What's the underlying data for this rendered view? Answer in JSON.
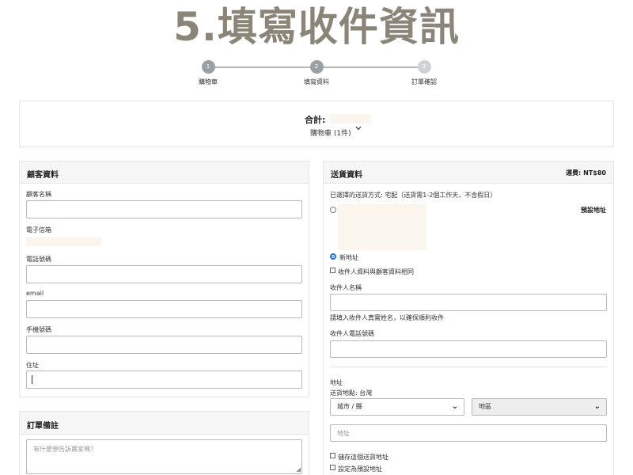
{
  "banner": {
    "title": "5.填寫收件資訊"
  },
  "steps": [
    {
      "number": "1",
      "label": "購物車",
      "color": "#9aa0a6"
    },
    {
      "number": "2",
      "label": "填寫資料",
      "color": "#9aa0a6"
    },
    {
      "number": "3",
      "label": "訂單確認",
      "color": "#cfd2d5"
    }
  ],
  "summary": {
    "total_label": "合計:",
    "cart_label": "購物車 (1件)"
  },
  "customer": {
    "title": "顧客資料",
    "name_label": "顧客名稱",
    "email_label": "電子信箱",
    "phone_label": "電話號碼",
    "email2_label": "email",
    "mobile_label": "手機號碼",
    "address_label": "住址"
  },
  "note": {
    "title": "訂單備註",
    "placeholder": "有什麼想告訴賣家嗎？"
  },
  "shipping": {
    "title": "送貨資料",
    "fee": "運費: NT$80",
    "method": "已選擇的送貨方式: 宅配（送貨需1-2個工作天，不含假日）",
    "default_address": "預設地址",
    "new_address": "新地址",
    "same_as_customer": "收件人資料與顧客資料相同",
    "recipient_name_label": "收件人名稱",
    "recipient_name_hint": "請填入收件人真實姓名，以確保順利收件",
    "recipient_phone_label": "收件人電話號碼",
    "address_label": "地址",
    "ship_region": "送貨地點: 台灣",
    "city_select": "城市 / 縣",
    "district_select": "地區",
    "address_placeholder": "地址",
    "save_address": "儲存這個送貨地址",
    "set_default": "設定為預設地址"
  }
}
